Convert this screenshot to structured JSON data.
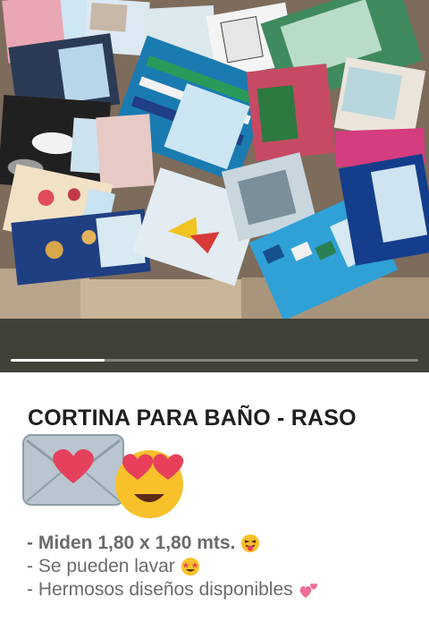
{
  "photo": {
    "description_icon": "curtains-photo",
    "carousel": {
      "current_slide": 1,
      "slide_count": 4,
      "progress_fraction": 0.23
    }
  },
  "post": {
    "title": "CORTINA PARA BAÑO - RASO",
    "title_emojis": [
      "love-letter-icon",
      "heart-eyes-icon"
    ],
    "lines": [
      {
        "text": "- Miden 1,80 x 1,80 mts.",
        "emoji": "tongue-wink-icon",
        "bold": true
      },
      {
        "text": "- Se pueden lavar",
        "emoji": "star-struck-icon",
        "bold": false
      },
      {
        "text": "- Hermosos diseños disponibles",
        "emoji": "two-hearts-icon",
        "bold": false
      }
    ]
  },
  "colors": {
    "accent": "#e8506a",
    "title": "#1f1f1f",
    "body_text": "#6b6b6b",
    "strip": "#3f4238"
  }
}
